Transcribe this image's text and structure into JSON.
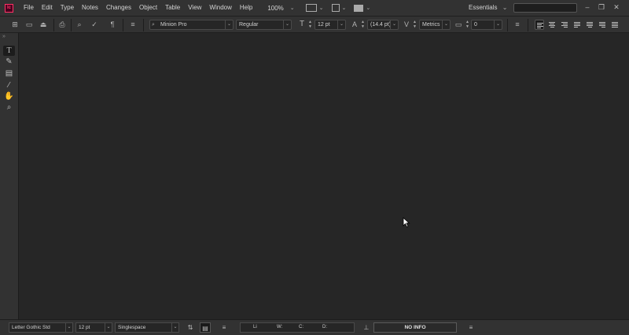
{
  "menubar": {
    "items": [
      "File",
      "Edit",
      "Type",
      "Notes",
      "Changes",
      "Object",
      "Table",
      "View",
      "Window",
      "Help"
    ],
    "zoom": "100%",
    "workspace": "Essentials",
    "logo": "Ic"
  },
  "controlbar": {
    "font_family": "Minion Pro",
    "font_style": "Regular",
    "font_size": "12 pt",
    "leading": "(14.4 pt)",
    "kerning": "Metrics",
    "tracking": "0"
  },
  "toolbox": {
    "tools": [
      "type-tool",
      "text-frame-tool",
      "note-tool",
      "eyedropper-tool",
      "hand-tool",
      "zoom-tool"
    ]
  },
  "bottombar": {
    "font_family": "Letter Gothic Std",
    "font_size": "12 pt",
    "spacing": "Singlespace",
    "stats_labels": [
      "Li",
      "W:",
      "C:",
      "D:"
    ],
    "info": "NO INFO"
  }
}
